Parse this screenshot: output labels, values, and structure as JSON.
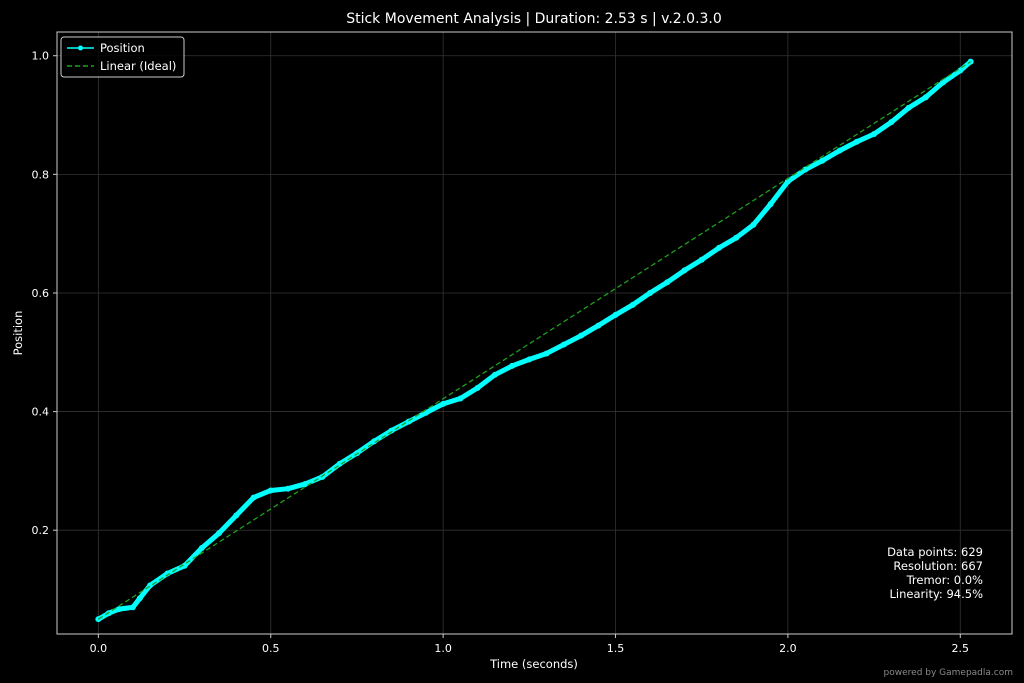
{
  "chart_data": {
    "type": "line",
    "title": "Stick Movement Analysis | Duration: 2.53 s | v.2.0.3.0",
    "xlabel": "Time (seconds)",
    "ylabel": "Position",
    "xlim": [
      -0.12,
      2.65
    ],
    "ylim": [
      0.025,
      1.04
    ],
    "xticks": [
      0.0,
      0.5,
      1.0,
      1.5,
      2.0,
      2.5
    ],
    "xtick_labels": [
      "0.0",
      "0.5",
      "1.0",
      "1.5",
      "2.0",
      "2.5"
    ],
    "yticks": [
      0.2,
      0.4,
      0.6,
      0.8,
      1.0
    ],
    "ytick_labels": [
      "0.2",
      "0.4",
      "0.6",
      "0.8",
      "1.0"
    ],
    "grid": true,
    "legend_position": "top-left",
    "series": [
      {
        "name": "Position",
        "color": "#00ffff",
        "style": "solid-markers",
        "x": [
          0.0,
          0.03,
          0.06,
          0.1,
          0.12,
          0.15,
          0.2,
          0.25,
          0.3,
          0.35,
          0.4,
          0.45,
          0.5,
          0.55,
          0.6,
          0.65,
          0.7,
          0.75,
          0.8,
          0.85,
          0.9,
          0.95,
          1.0,
          1.05,
          1.1,
          1.15,
          1.2,
          1.25,
          1.3,
          1.35,
          1.4,
          1.45,
          1.5,
          1.55,
          1.6,
          1.65,
          1.7,
          1.75,
          1.8,
          1.85,
          1.9,
          1.95,
          2.0,
          2.05,
          2.1,
          2.15,
          2.2,
          2.25,
          2.3,
          2.35,
          2.4,
          2.45,
          2.5,
          2.53
        ],
        "y": [
          0.05,
          0.06,
          0.067,
          0.07,
          0.085,
          0.107,
          0.127,
          0.14,
          0.17,
          0.195,
          0.225,
          0.255,
          0.267,
          0.27,
          0.278,
          0.29,
          0.312,
          0.33,
          0.35,
          0.368,
          0.383,
          0.398,
          0.413,
          0.422,
          0.44,
          0.462,
          0.477,
          0.488,
          0.498,
          0.513,
          0.528,
          0.545,
          0.563,
          0.58,
          0.6,
          0.618,
          0.638,
          0.656,
          0.676,
          0.693,
          0.715,
          0.75,
          0.788,
          0.808,
          0.823,
          0.84,
          0.855,
          0.868,
          0.888,
          0.912,
          0.93,
          0.955,
          0.975,
          0.99
        ]
      },
      {
        "name": "Linear (Ideal)",
        "color": "#1ea01e",
        "style": "dashed",
        "x": [
          0.0,
          2.53
        ],
        "y": [
          0.05,
          0.99
        ]
      }
    ],
    "annotations": [
      "Data points: 629",
      "Resolution: 667",
      "Tremor: 0.0%",
      "Linearity: 94.5%"
    ]
  },
  "footer": {
    "credit": "powered by Gamepadla.com"
  },
  "colors": {
    "background": "#000000",
    "axes": "#cccccc",
    "grid": "#333333"
  }
}
